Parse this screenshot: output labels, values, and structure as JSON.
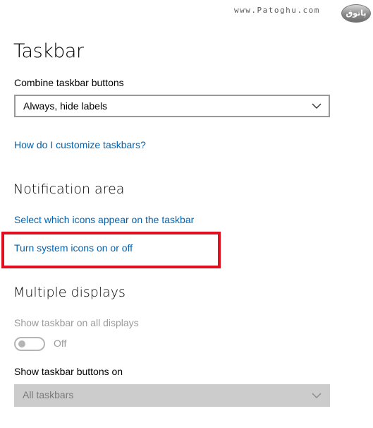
{
  "watermark": {
    "text": "www.Patoghu.com",
    "logo_text": "پاتوق"
  },
  "page": {
    "title": "Taskbar"
  },
  "combine": {
    "label": "Combine taskbar buttons",
    "value": "Always, hide labels",
    "chevron_icon": "chevron-down-icon"
  },
  "links": {
    "customize": "How do I customize taskbars?",
    "select_icons": "Select which icons appear on the taskbar",
    "system_icons": "Turn system icons on or off"
  },
  "notification": {
    "heading": "Notification area"
  },
  "multiple_displays": {
    "heading": "Multiple displays",
    "show_all_label": "Show taskbar on all displays",
    "toggle_state": "Off",
    "toggle_on": false,
    "buttons_on_label": "Show taskbar buttons on",
    "buttons_on_value": "All taskbars"
  },
  "colors": {
    "link": "#0063b1",
    "highlight": "#e0101e",
    "disabled_text": "#9a9a9a",
    "disabled_field": "#cccccc"
  }
}
